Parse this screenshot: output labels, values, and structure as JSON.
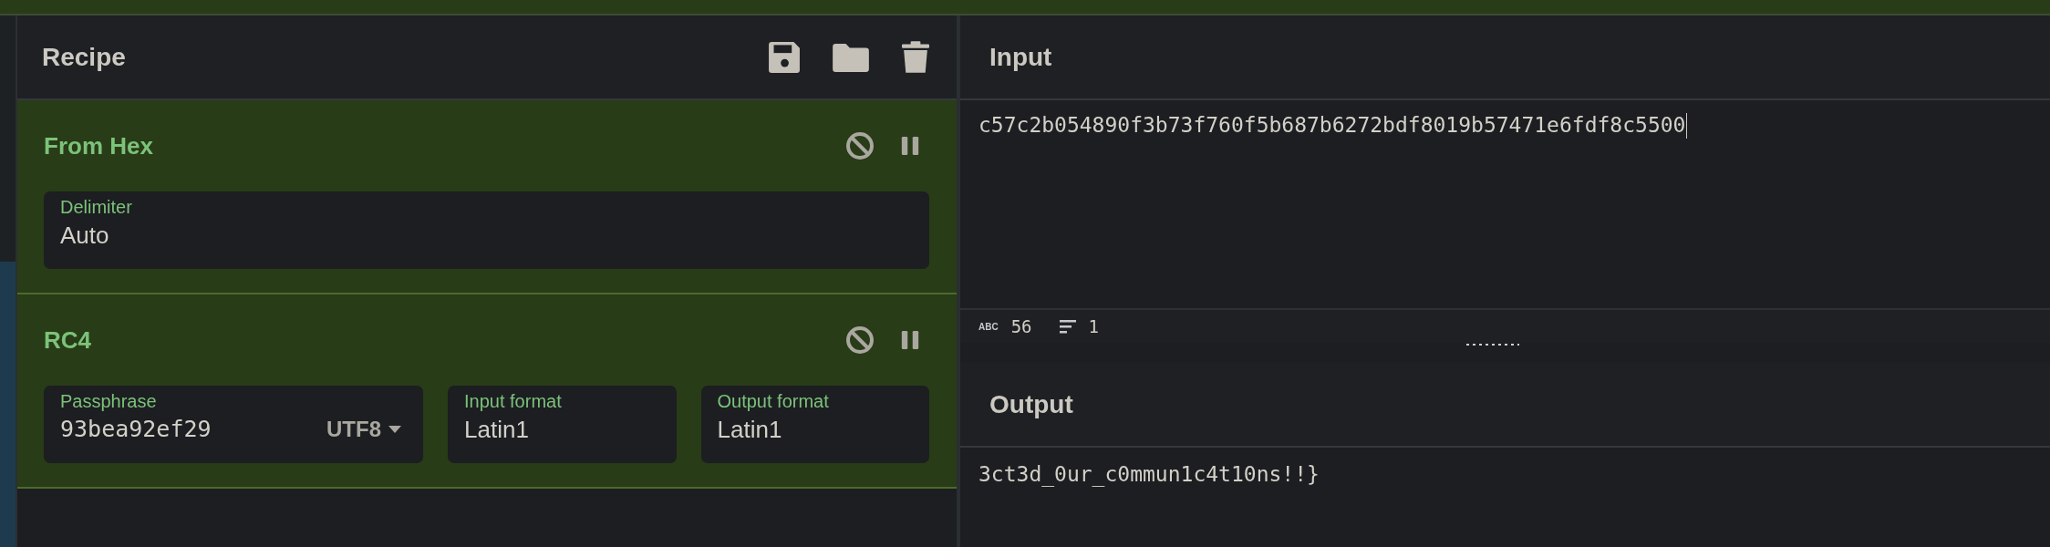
{
  "recipe": {
    "title": "Recipe"
  },
  "operations": [
    {
      "name": "From Hex",
      "args": [
        {
          "kind": "text",
          "label": "Delimiter",
          "value": "Auto"
        }
      ]
    },
    {
      "name": "RC4",
      "args": [
        {
          "kind": "toggle",
          "label": "Passphrase",
          "value": "93bea92ef29",
          "format": "UTF8"
        },
        {
          "kind": "text",
          "label": "Input format",
          "value": "Latin1"
        },
        {
          "kind": "text",
          "label": "Output format",
          "value": "Latin1"
        }
      ]
    }
  ],
  "input": {
    "title": "Input",
    "text": "c57c2b054890f3b73f760f5b687b6272bdf8019b57471e6fdf8c5500",
    "stats": [
      {
        "kind": "length",
        "glyph": "ABC",
        "value": "56"
      },
      {
        "kind": "lines",
        "value": "1"
      }
    ]
  },
  "output": {
    "title": "Output",
    "text": "3ct3d_0ur_c0mmun1c4t10ns!!}"
  }
}
